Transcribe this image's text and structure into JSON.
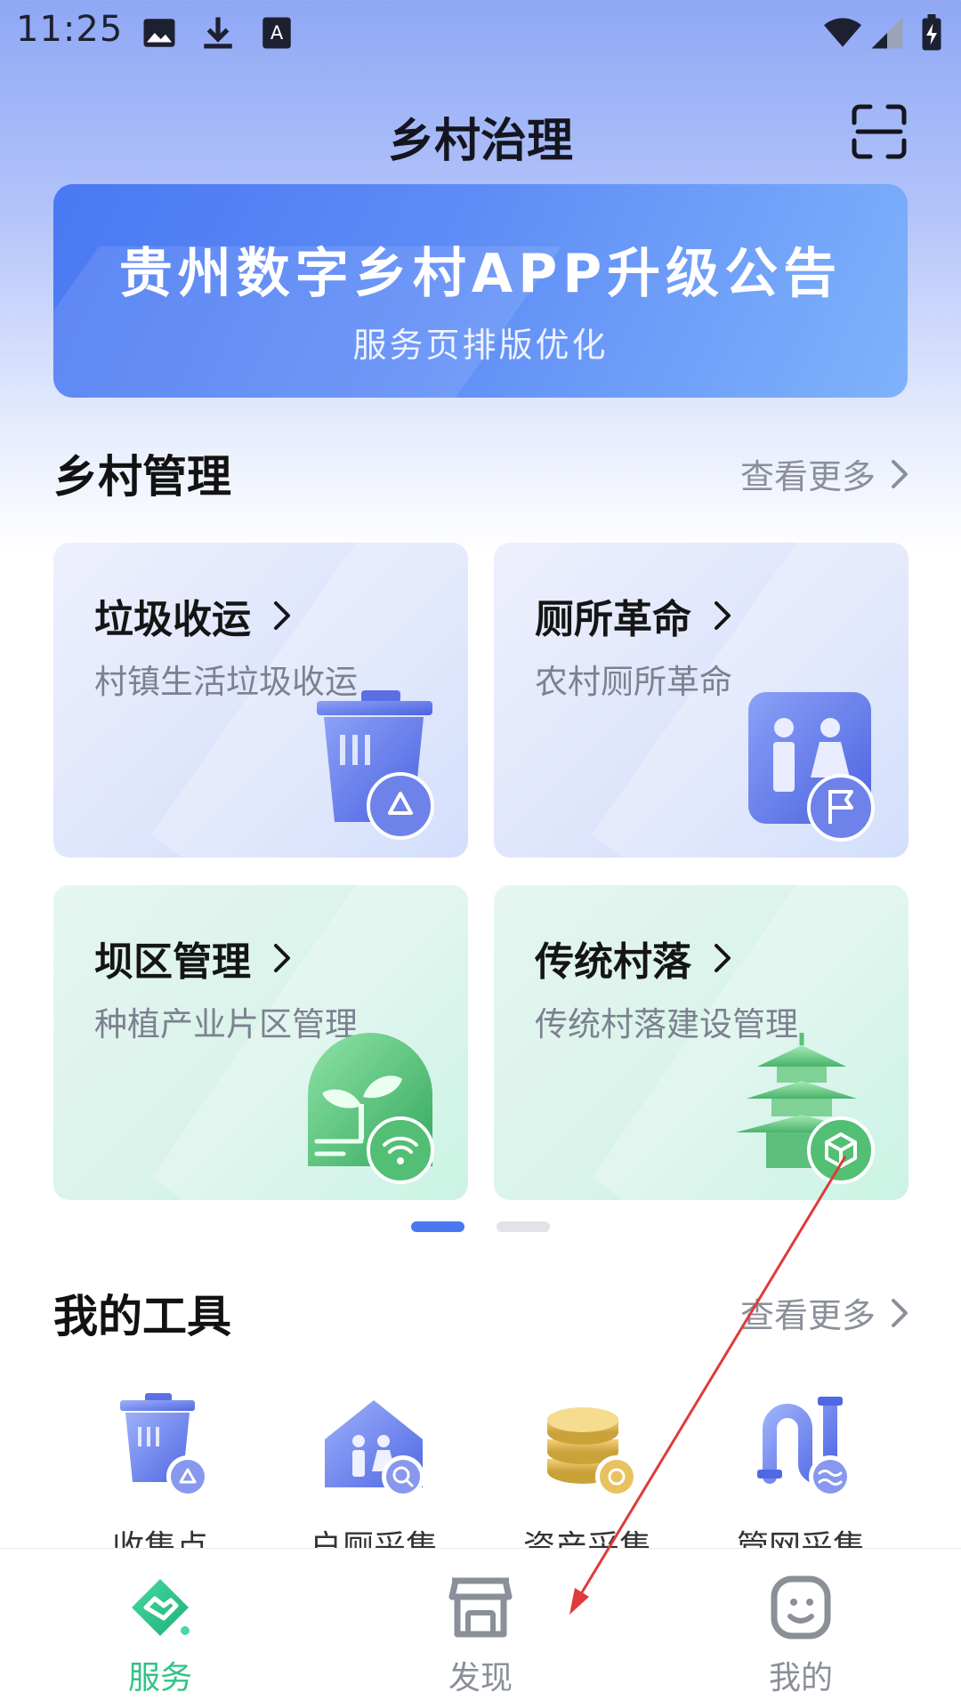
{
  "status_bar": {
    "time": "11:25"
  },
  "header": {
    "title": "乡村治理"
  },
  "banner": {
    "title": "贵州数字乡村APP升级公告",
    "subtitle": "服务页排版优化"
  },
  "rural_management": {
    "title": "乡村管理",
    "more": "查看更多",
    "cards": [
      {
        "title": "垃圾收运",
        "subtitle": "村镇生活垃圾收运",
        "icon": "trash-recycle-icon"
      },
      {
        "title": "厕所革命",
        "subtitle": "农村厕所革命",
        "icon": "toilet-flag-icon"
      },
      {
        "title": "坝区管理",
        "subtitle": "种植产业片区管理",
        "icon": "sprout-wifi-icon"
      },
      {
        "title": "传统村落",
        "subtitle": "传统村落建设管理",
        "icon": "pagoda-cube-icon"
      }
    ]
  },
  "pager": {
    "active_index": 0,
    "count": 2
  },
  "my_tools": {
    "title": "我的工具",
    "more": "查看更多",
    "items": [
      {
        "label": "收集点",
        "icon": "collection-bin-icon"
      },
      {
        "label": "户厕采集",
        "icon": "household-toilet-search-icon"
      },
      {
        "label": "资产采集",
        "icon": "coins-asset-icon"
      },
      {
        "label": "管网采集",
        "icon": "pipe-network-icon"
      }
    ]
  },
  "tabbar": {
    "items": [
      {
        "label": "服务",
        "active": true
      },
      {
        "label": "发现",
        "active": false
      },
      {
        "label": "我的",
        "active": false
      }
    ]
  },
  "colors": {
    "accent_green": "#2ec487",
    "accent_blue": "#4a78f2",
    "inactive": "#8a8f99"
  }
}
